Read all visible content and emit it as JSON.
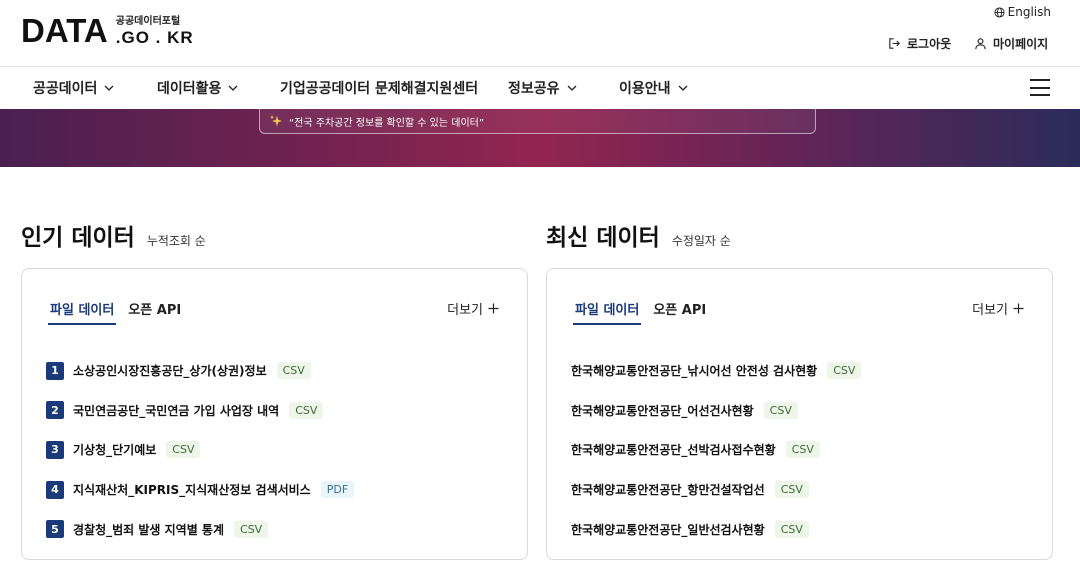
{
  "header": {
    "logo_main": "DATA",
    "logo_kr": "공공데이터포털",
    "logo_domain": ".GO . KR",
    "lang": "English",
    "logout": "로그아웃",
    "mypage": "마이페이지"
  },
  "nav": {
    "items": [
      {
        "label": "공공데이터",
        "icon": "chevron-down-icon"
      },
      {
        "label": "데이터활용",
        "icon": "chevron-down-icon"
      },
      {
        "label": "기업공공데이터 문제해결지원센터"
      },
      {
        "label": "정보공유",
        "icon": "chevron-down-icon"
      },
      {
        "label": "이용안내",
        "icon": "chevron-down-icon"
      }
    ],
    "menu_icon": "hamburger-menu-icon"
  },
  "banner": {
    "text": "“전국 주차공간 정보를 확인할 수 있는 데이터”",
    "icon": "sparkle-icon"
  },
  "popular": {
    "title": "인기 데이터",
    "sort": "누적조회 순",
    "tabs": [
      "파일 데이터",
      "오픈 API"
    ],
    "more": "더보기",
    "items": [
      {
        "rank": "1",
        "title": "소상공인시장진흥공단_상가(상권)정보",
        "format": "CSV"
      },
      {
        "rank": "2",
        "title": "국민연금공단_국민연금 가입 사업장 내역",
        "format": "CSV"
      },
      {
        "rank": "3",
        "title": "기상청_단기예보",
        "format": "CSV"
      },
      {
        "rank": "4",
        "title": "지식재산처_KIPRIS_지식재산정보 검색서비스",
        "format": "PDF"
      },
      {
        "rank": "5",
        "title": "경찰청_범죄 발생 지역별 통계",
        "format": "CSV"
      }
    ]
  },
  "latest": {
    "title": "최신 데이터",
    "sort": "수정일자 순",
    "tabs": [
      "파일 데이터",
      "오픈 API"
    ],
    "more": "더보기",
    "items": [
      {
        "title": "한국해양교통안전공단_낚시어선 안전성 검사현황",
        "format": "CSV"
      },
      {
        "title": "한국해양교통안전공단_어선건사현황",
        "format": "CSV"
      },
      {
        "title": "한국해양교통안전공단_선박검사접수현황",
        "format": "CSV"
      },
      {
        "title": "한국해양교통안전공단_항만건설작업선",
        "format": "CSV"
      },
      {
        "title": "한국해양교통안전공단_일반선검사현황",
        "format": "CSV"
      }
    ]
  },
  "colors": {
    "accent": "#1b3a7a",
    "csv_bg": "#eef6ea",
    "pdf_bg": "#e9f4fb"
  }
}
